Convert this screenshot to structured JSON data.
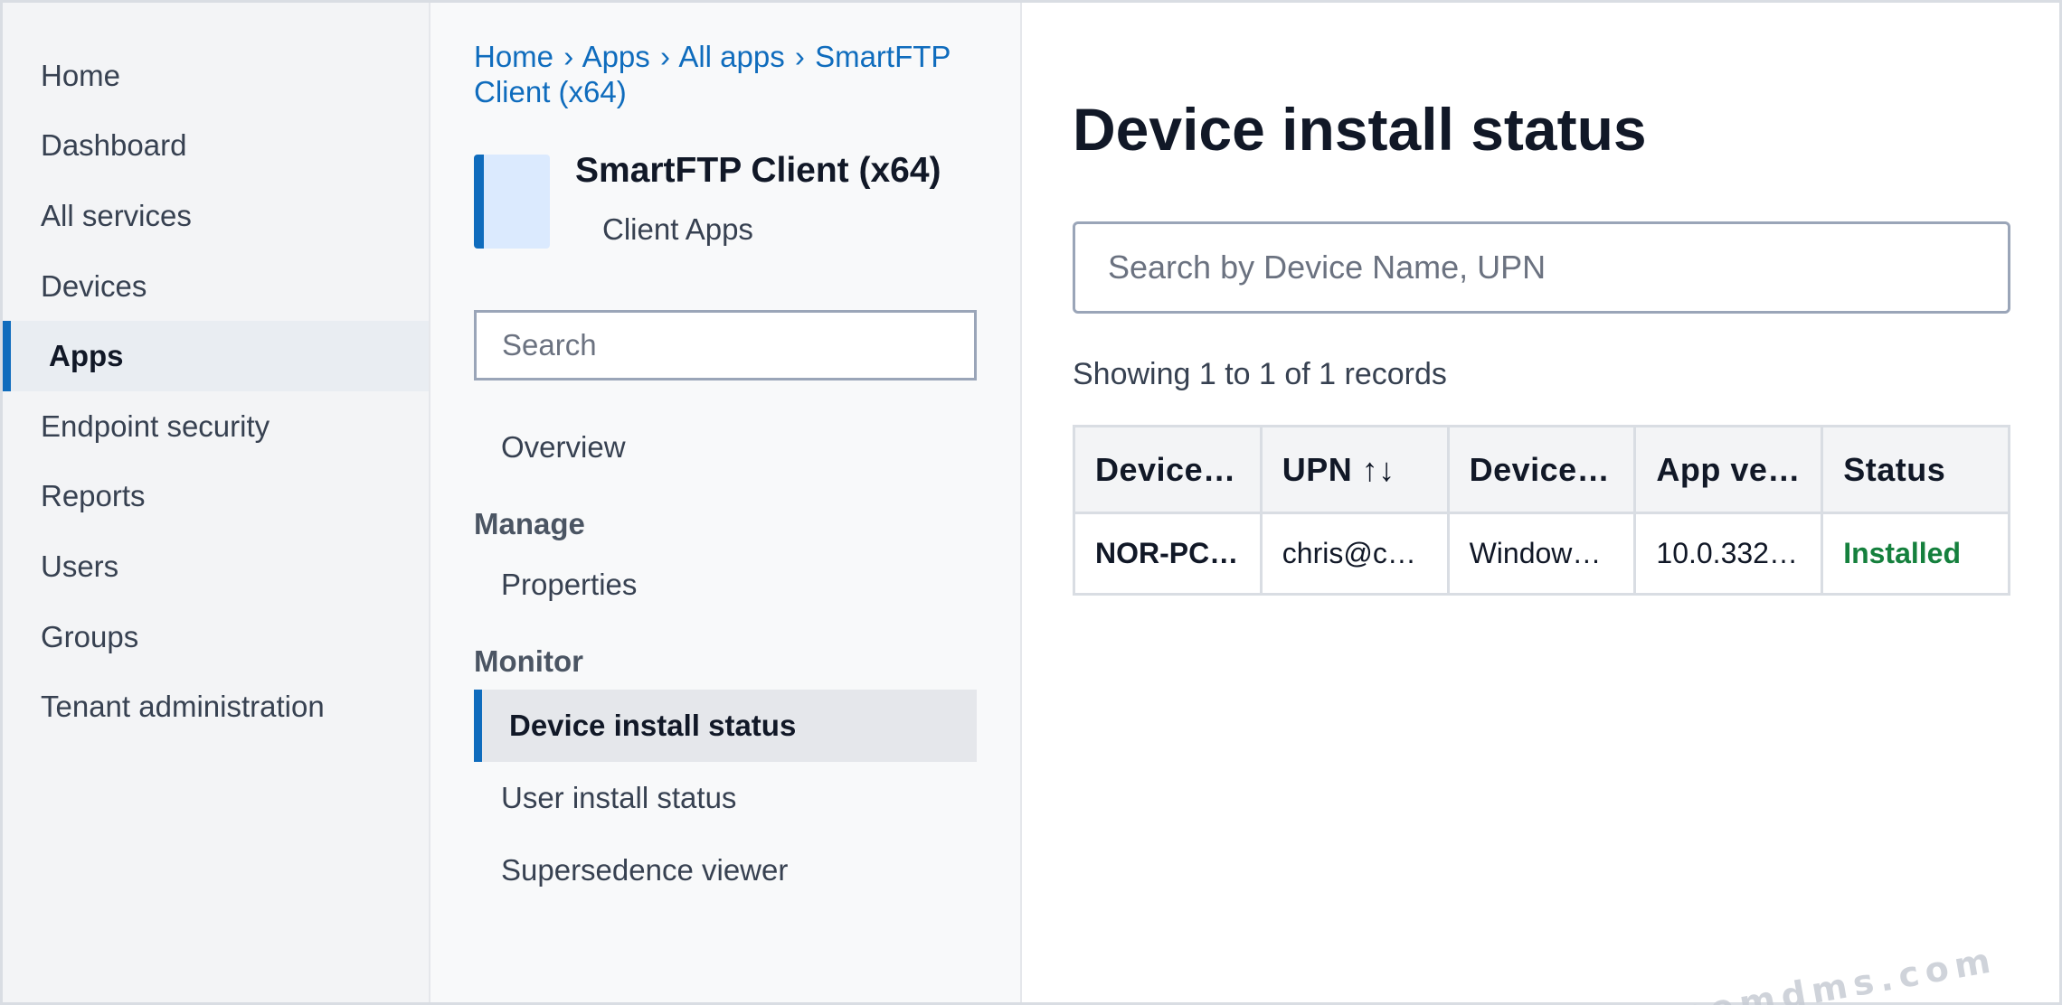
{
  "nav": {
    "items": [
      {
        "label": "Home"
      },
      {
        "label": "Dashboard"
      },
      {
        "label": "All services"
      },
      {
        "label": "Devices"
      },
      {
        "label": "Apps"
      },
      {
        "label": "Endpoint security"
      },
      {
        "label": "Reports"
      },
      {
        "label": "Users"
      },
      {
        "label": "Groups"
      },
      {
        "label": "Tenant administration"
      }
    ],
    "active": "Apps"
  },
  "blade": {
    "breadcrumb": [
      "Home",
      "Apps",
      "All apps",
      "SmartFTP Client (x64)"
    ],
    "breadcrumb_separator": "›",
    "app_title": "SmartFTP Client (x64)",
    "app_subtitle": "Client Apps",
    "search_placeholder": "Search",
    "overview": "Overview",
    "manage_heading": "Manage",
    "properties": "Properties",
    "monitor_heading": "Monitor",
    "device_install_status": "Device install status",
    "user_install_status": "User install status",
    "supersedence_viewer": "Supersedence viewer"
  },
  "main": {
    "title": "Device install status",
    "search_placeholder": "Search by Device Name, UPN",
    "records_text": "Showing 1 to 1 of 1 records",
    "columns": [
      "Device…",
      "UPN ↑↓",
      "Device…",
      "App ve…",
      "Status"
    ],
    "rows": [
      {
        "device": "NOR-PC…",
        "upn": "chris@c…",
        "platform": "Windows…",
        "app_version": "10.0.332…",
        "status": "Installed"
      }
    ]
  },
  "watermark": "intunemdms.com",
  "colors": {
    "accent": "#0f6cbd",
    "status_installed": "#15803d"
  }
}
